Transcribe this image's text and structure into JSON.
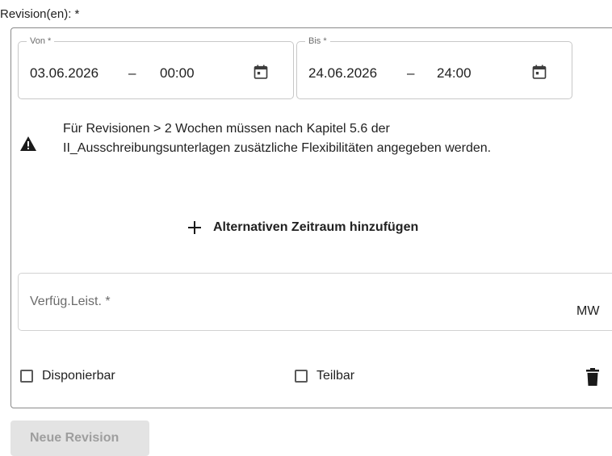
{
  "section": {
    "label": "Revision(en): *"
  },
  "date_range": {
    "from": {
      "legend": "Von *",
      "date": "03.06.2026",
      "separator": "–",
      "time": "00:00"
    },
    "to": {
      "legend": "Bis *",
      "date": "24.06.2026",
      "separator": "–",
      "time": "24:00"
    }
  },
  "warning": {
    "icon": "warning-triangle-icon",
    "line1": "Für Revisionen > 2 Wochen müssen nach Kapitel 5.6 der",
    "line2": "II_Ausschreibungsunterlagen zusätzliche Flexibilitäten angegeben werden."
  },
  "add_alternative": {
    "icon": "plus-icon",
    "label": "Alternativen Zeitraum hinzufügen"
  },
  "power_field": {
    "placeholder": "Verfüg.Leist. *",
    "unit": "MW"
  },
  "checkboxes": [
    {
      "label": "Disponierbar",
      "checked": false
    },
    {
      "label": "Teilbar",
      "checked": false
    }
  ],
  "actions": {
    "delete_icon": "trash-icon",
    "new_revision_label": "Neue Revision",
    "new_revision_disabled": true
  },
  "colors": {
    "text": "#212121",
    "muted": "#6b6b6b",
    "disabled_bg": "#e3e3e3",
    "disabled_text": "#9e9e9e"
  }
}
